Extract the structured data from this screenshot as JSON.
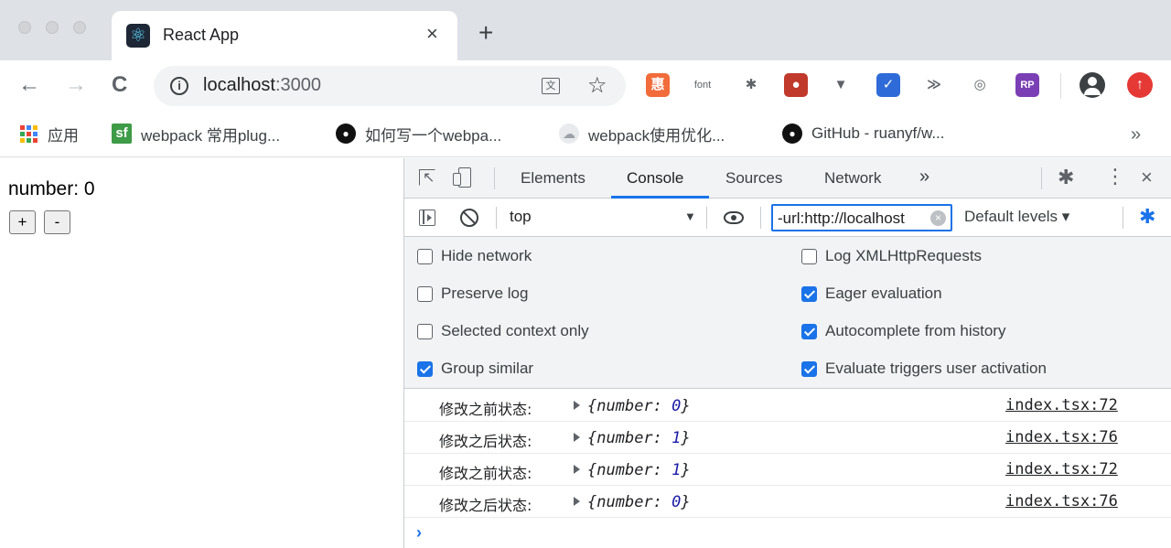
{
  "tab": {
    "title": "React App",
    "close": "×",
    "favicon": "⚛"
  },
  "new_tab": "+",
  "nav": {
    "back": "←",
    "forward": "→",
    "reload": "C"
  },
  "address": {
    "host": "localhost",
    "port": ":3000",
    "info": "i",
    "star": "☆"
  },
  "extensions": [
    {
      "name": "ext-hui-icon",
      "label": "惠",
      "color": "#f26b3a"
    },
    {
      "name": "ext-font-icon",
      "label": "font",
      "color": "#ffffff"
    },
    {
      "name": "ext-star-icon",
      "label": "✱",
      "color": "#ffffff"
    },
    {
      "name": "ext-ladybug-icon",
      "label": "●",
      "color": "#c0392b"
    },
    {
      "name": "ext-vue-icon",
      "label": "▼",
      "color": "#ffffff"
    },
    {
      "name": "ext-check-icon",
      "label": "✓",
      "color": "#2f6bd8"
    },
    {
      "name": "ext-chevrons-icon",
      "label": "≫",
      "color": "#ffffff"
    },
    {
      "name": "ext-record-icon",
      "label": "◎",
      "color": "#ffffff"
    },
    {
      "name": "ext-rp-icon",
      "label": "RP",
      "color": "#7b3fb5"
    }
  ],
  "update_icon": "↑",
  "bookmarks": {
    "apps": "应用",
    "sf": "webpack 常用plug...",
    "webpack_howto": "如何写一个webpa...",
    "webpack_opt": "webpack使用优化...",
    "github": "GitHub - ruanyf/w...",
    "more": "»",
    "sf_icon": "sf",
    "gh_icon": "●"
  },
  "page": {
    "number_text": "number: 0",
    "plus": "+",
    "minus": "-"
  },
  "devtools": {
    "tabs": [
      "Elements",
      "Console",
      "Sources",
      "Network"
    ],
    "more_tabs": "»",
    "gear": "✱",
    "kebab": "⋮",
    "close": "×",
    "context": "top",
    "context_caret": "▼",
    "filter": "-url:http://localhost",
    "filter_clear": "×",
    "levels": "Default levels ▾",
    "settings_left": [
      {
        "label": "Hide network",
        "checked": false
      },
      {
        "label": "Preserve log",
        "checked": false
      },
      {
        "label": "Selected context only",
        "checked": false
      },
      {
        "label": "Group similar",
        "checked": true
      }
    ],
    "settings_right": [
      {
        "label": "Log XMLHttpRequests",
        "checked": false
      },
      {
        "label": "Eager evaluation",
        "checked": true
      },
      {
        "label": "Autocomplete from history",
        "checked": true
      },
      {
        "label": "Evaluate triggers user activation",
        "checked": true
      }
    ],
    "logs": [
      {
        "label": "修改之前状态:",
        "key": "number",
        "value": "0",
        "source": "index.tsx:72"
      },
      {
        "label": "修改之后状态:",
        "key": "number",
        "value": "1",
        "source": "index.tsx:76"
      },
      {
        "label": "修改之前状态:",
        "key": "number",
        "value": "1",
        "source": "index.tsx:72"
      },
      {
        "label": "修改之后状态:",
        "key": "number",
        "value": "0",
        "source": "index.tsx:76"
      }
    ],
    "prompt": "›"
  }
}
